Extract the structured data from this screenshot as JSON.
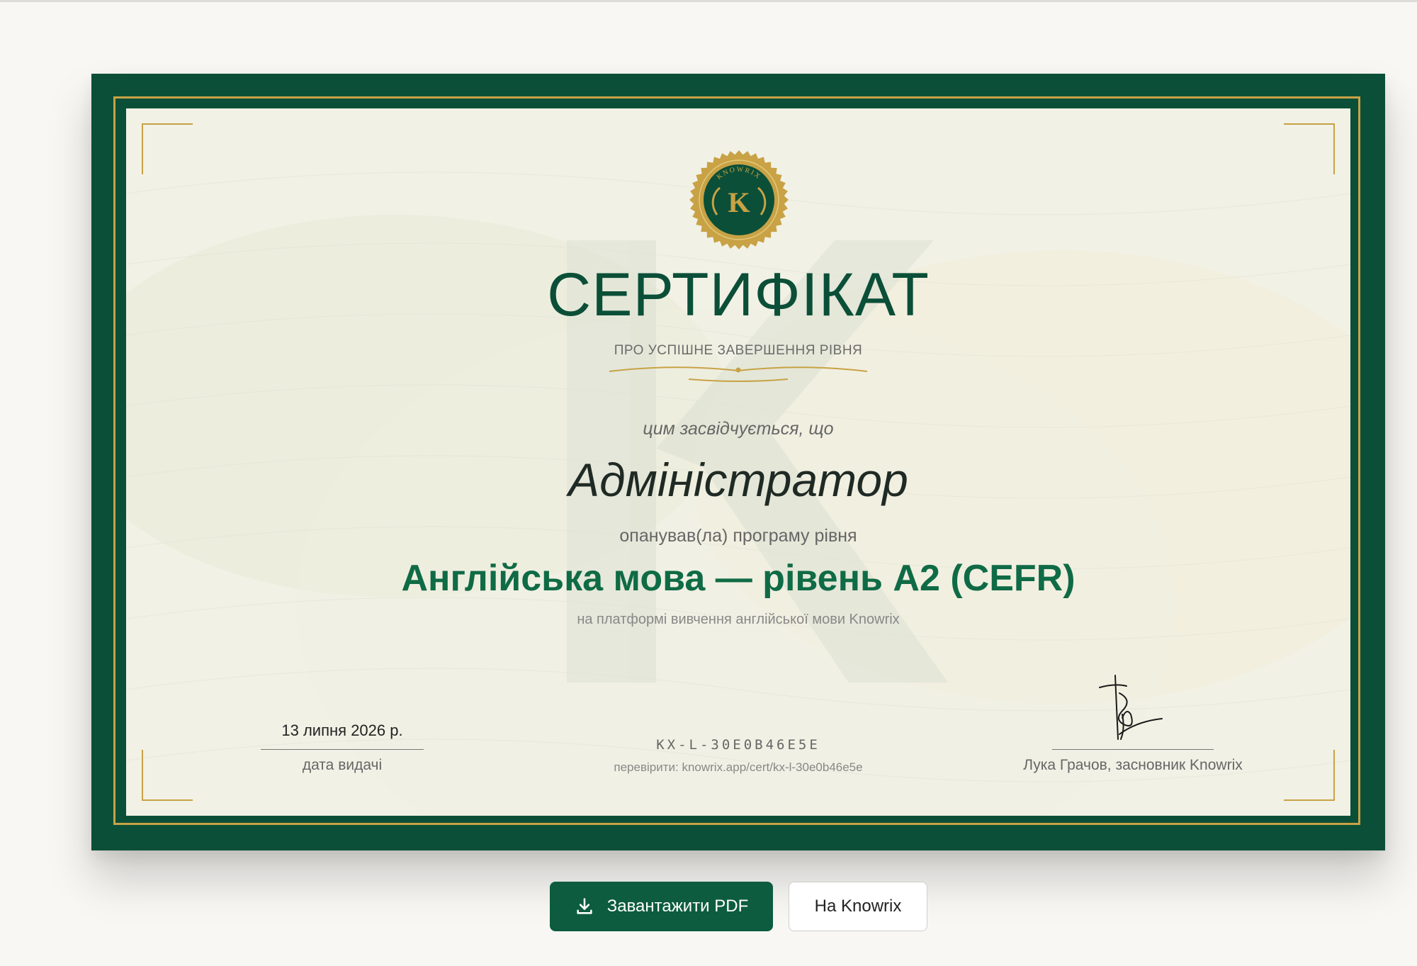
{
  "certificate": {
    "seal_text": "KNOWRIX",
    "seal_letter": "K",
    "title": "СЕРТИФІКАТ",
    "subtitle": "ПРО УСПІШНЕ ЗАВЕРШЕННЯ РІВНЯ",
    "certify_text": "цим засвідчується, що",
    "recipient_name": "Адміністратор",
    "mastered_text": "опанував(ла) програму рівня",
    "program": "Англійська мова — рівень A2 (CEFR)",
    "platform_text": "на платформі вивчення англійської мови Knowrix",
    "watermark_letter": "K",
    "issue_date": "13 липня 2026 р.",
    "issue_date_label": "дата видачі",
    "certificate_id": "KX-L-30E0B46E5E",
    "verify_text": "перевірити: knowrix.app/cert/kx-l-30e0b46e5e",
    "signatory": "Лука Грачов, засновник Knowrix"
  },
  "actions": {
    "download_pdf": "Завантажити PDF",
    "back_to_knowrix": "На Knowrix"
  },
  "colors": {
    "border_green": "#0b4f38",
    "gold": "#c8a245",
    "accent_green": "#0f6b45",
    "paper": "#f1f1e6"
  },
  "icons": {
    "download": "download-icon"
  }
}
